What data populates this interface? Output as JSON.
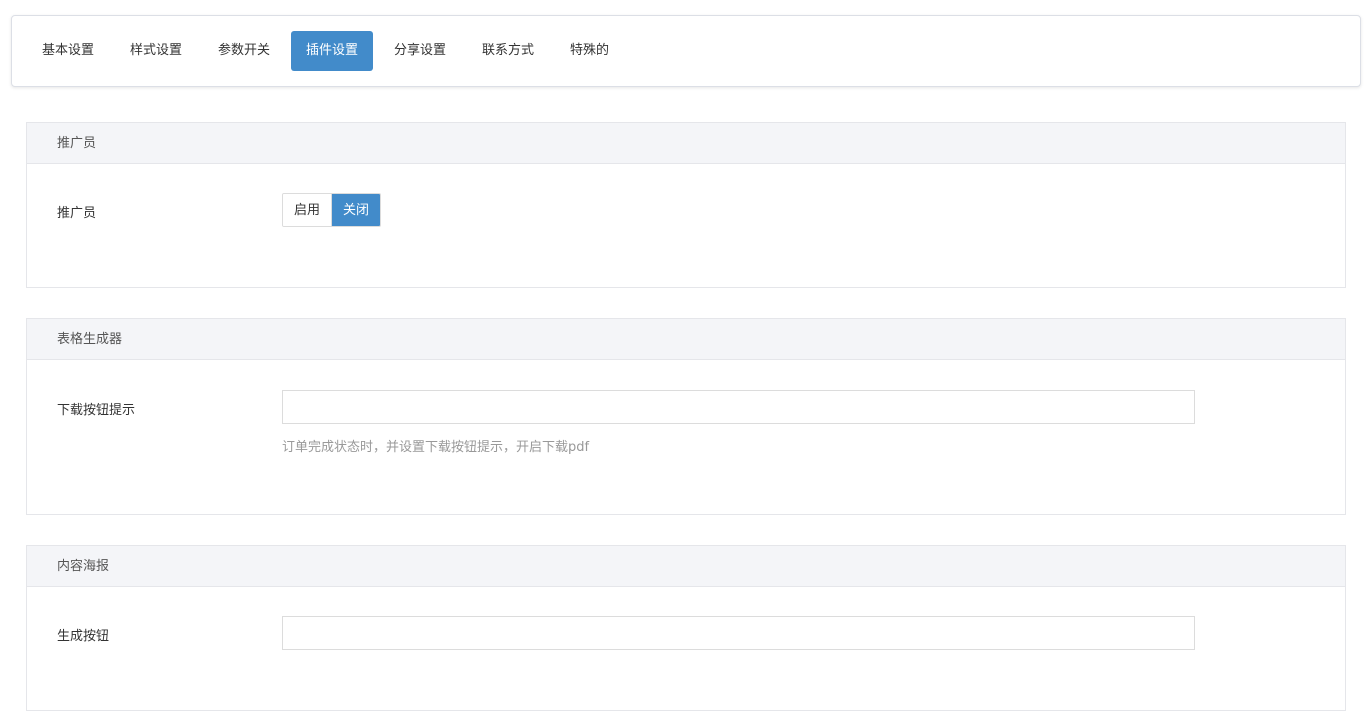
{
  "tabs": [
    {
      "label": "基本设置",
      "active": false
    },
    {
      "label": "样式设置",
      "active": false
    },
    {
      "label": "参数开关",
      "active": false
    },
    {
      "label": "插件设置",
      "active": true
    },
    {
      "label": "分享设置",
      "active": false
    },
    {
      "label": "联系方式",
      "active": false
    },
    {
      "label": "特殊的",
      "active": false
    }
  ],
  "promoter": {
    "heading": "推广员",
    "label": "推广员",
    "toggle": {
      "on_label": "启用",
      "off_label": "关闭",
      "selected": "关闭"
    }
  },
  "table_generator": {
    "heading": "表格生成器",
    "label": "下载按钮提示",
    "value": "",
    "placeholder": "",
    "help": "订单完成状态时，并设置下载按钮提示，开启下载pdf"
  },
  "content_poster": {
    "heading": "内容海报",
    "label": "生成按钮",
    "value": "",
    "placeholder": ""
  },
  "colors": {
    "accent": "#428bca",
    "panel_heading_bg": "#f4f5f8",
    "border": "#e5e6ea"
  }
}
